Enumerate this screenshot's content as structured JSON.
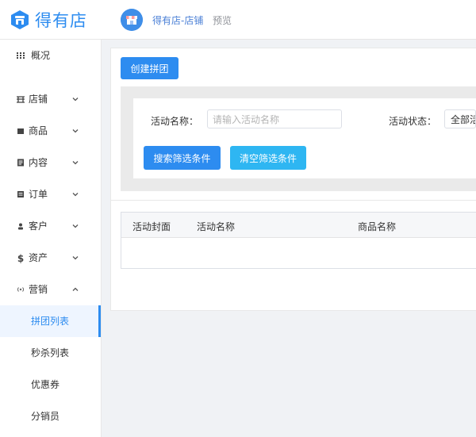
{
  "header": {
    "logo_text": "得有店",
    "shop_name": "得有店-店铺",
    "preview_label": "预览"
  },
  "sidebar": {
    "items": [
      {
        "label": "概况",
        "icon": "grid-icon"
      },
      {
        "label": "店铺",
        "icon": "store-icon",
        "expanded": false
      },
      {
        "label": "商品",
        "icon": "goods-icon",
        "expanded": false
      },
      {
        "label": "内容",
        "icon": "content-icon",
        "expanded": false
      },
      {
        "label": "订单",
        "icon": "order-icon",
        "expanded": false
      },
      {
        "label": "客户",
        "icon": "user-icon",
        "expanded": false
      },
      {
        "label": "资产",
        "icon": "dollar-icon",
        "expanded": false
      },
      {
        "label": "营销",
        "icon": "broadcast-icon",
        "expanded": true
      }
    ],
    "submenu": [
      {
        "label": "拼团列表",
        "active": true
      },
      {
        "label": "秒杀列表",
        "active": false
      },
      {
        "label": "优惠券",
        "active": false
      },
      {
        "label": "分销员",
        "active": false
      }
    ]
  },
  "main": {
    "create_button": "创建拼团",
    "filters": {
      "name_label": "活动名称：",
      "name_placeholder": "请输入活动名称",
      "status_label": "活动状态：",
      "status_value": "全部活动"
    },
    "search_button": "搜索筛选条件",
    "clear_button": "清空筛选条件",
    "table": {
      "columns": [
        "活动封面",
        "活动名称",
        "商品名称"
      ],
      "rows": []
    }
  },
  "colors": {
    "accent": "#2d8cf0",
    "clear_button": "#2eb6f2"
  }
}
